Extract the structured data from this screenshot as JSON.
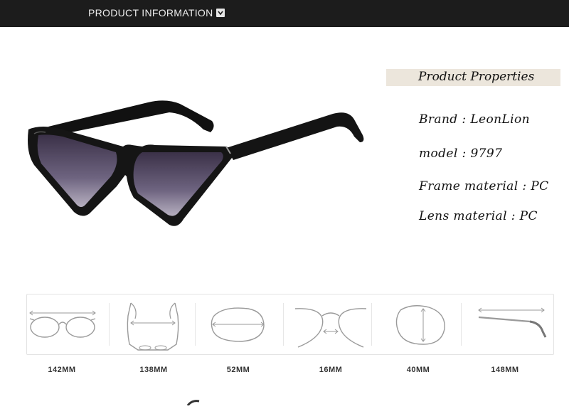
{
  "header": {
    "title": "PRODUCT INFORMATION",
    "toggle_icon": "chevron-down-icon"
  },
  "product_image": {
    "icon": "cat-eye-sunglasses"
  },
  "properties": {
    "heading": "Product Properties",
    "brand": "Brand : LeonLion",
    "model": "model : 9797",
    "frame_material": "Frame material : PC",
    "lens_material": "Lens material : PC"
  },
  "dimensions": [
    {
      "label": "142MM",
      "icon": "frame-width-icon"
    },
    {
      "label": "138MM",
      "icon": "temple-spread-icon"
    },
    {
      "label": "52MM",
      "icon": "lens-width-icon"
    },
    {
      "label": "16MM",
      "icon": "bridge-width-icon"
    },
    {
      "label": "40MM",
      "icon": "lens-height-icon"
    },
    {
      "label": "148MM",
      "icon": "temple-length-icon"
    }
  ],
  "colors": {
    "header_bg": "#1c1c1c",
    "heading_bg": "#ece6dc",
    "lens": "#5a4f6e"
  }
}
